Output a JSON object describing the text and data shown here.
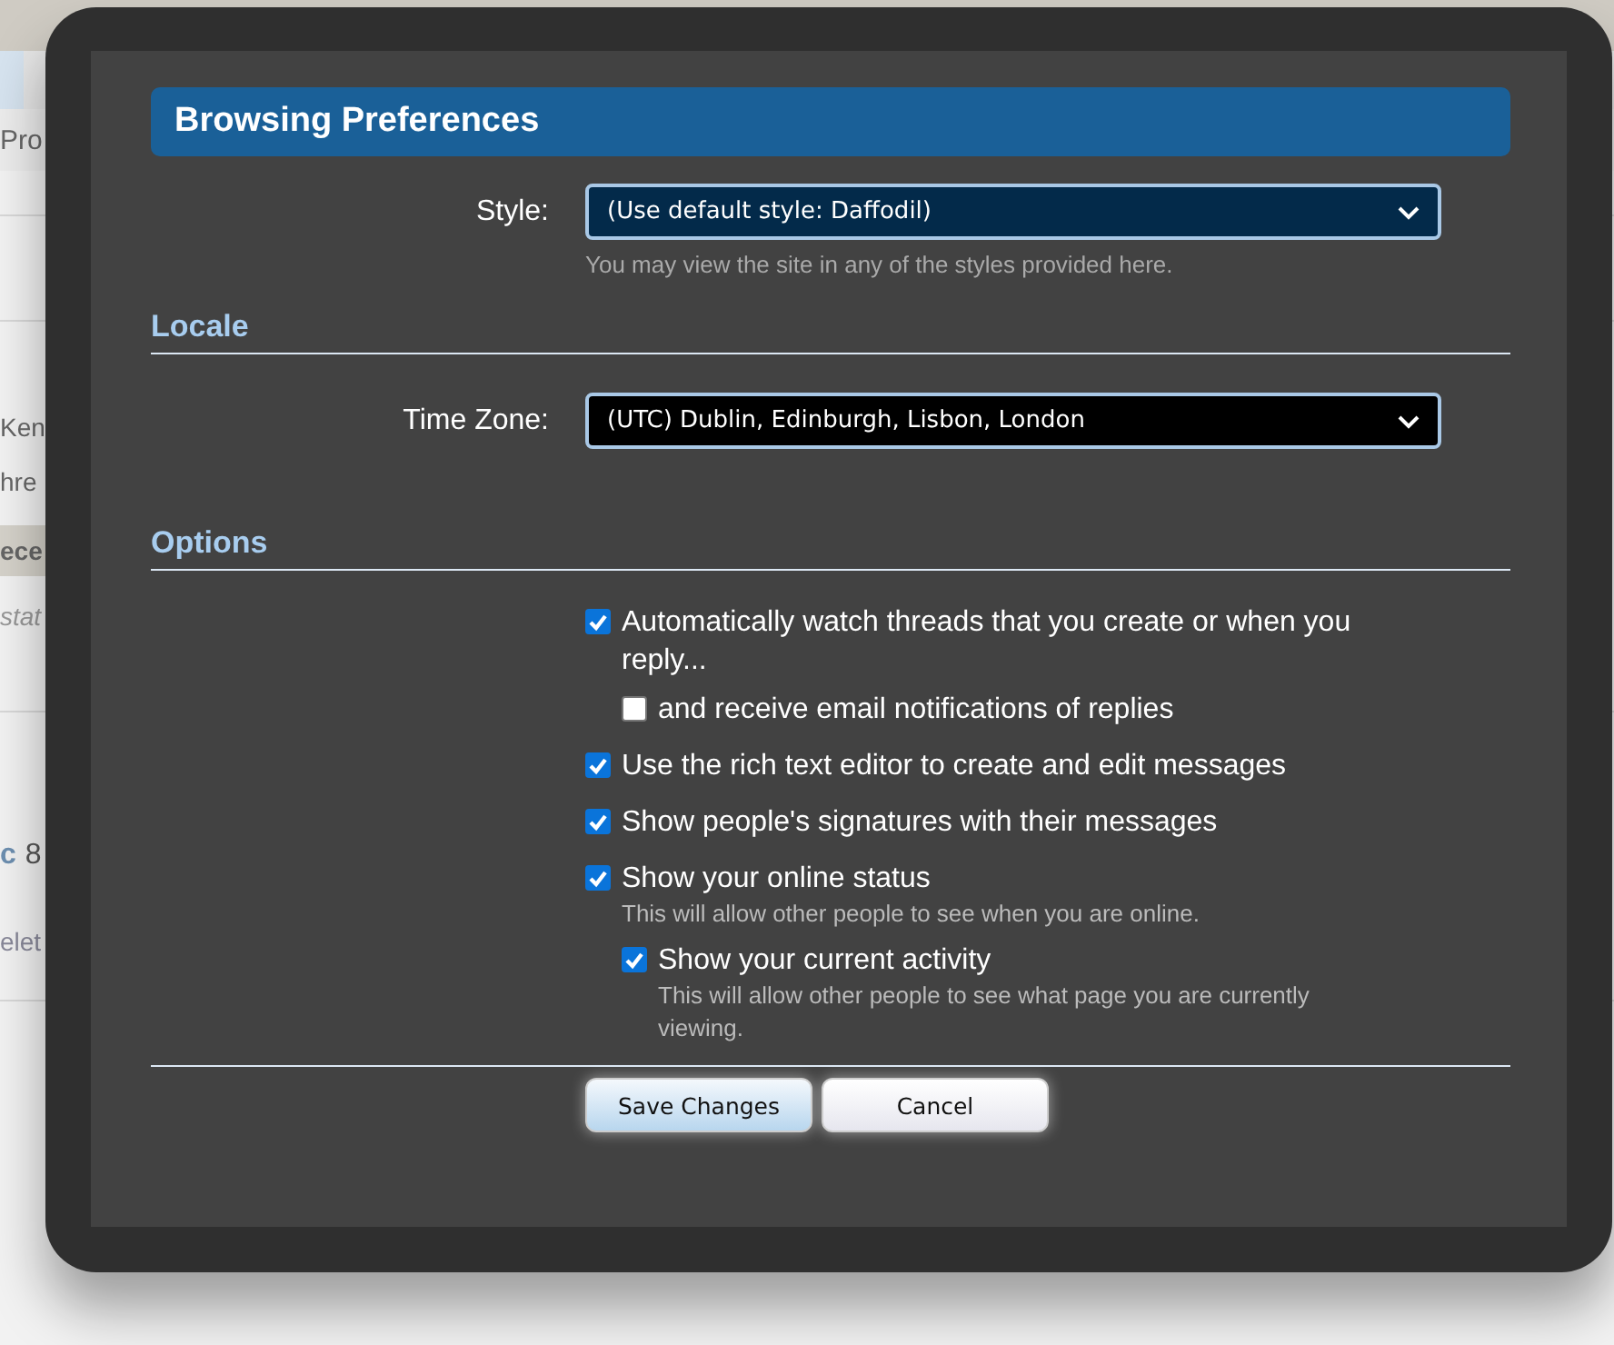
{
  "background_page": {
    "nav_tab": {
      "selected": true
    },
    "profile_tab": "Pro",
    "user_name": "Ken",
    "activity": "hre",
    "profile_tabs": [
      {
        "label": "ece"
      }
    ],
    "status_placeholder": "stat",
    "post": {
      "prefix": "c",
      "text": "8"
    },
    "post_actions": [
      "elet"
    ]
  },
  "dialog": {
    "title": "Browsing Preferences",
    "style": {
      "label": "Style:",
      "value": "(Use default style: Daffodil)",
      "hint": "You may view the site in any of the styles provided here."
    },
    "locale_heading": "Locale",
    "time_zone": {
      "label": "Time Zone:",
      "value": "(UTC) Dublin, Edinburgh, Lisbon, London"
    },
    "options_heading": "Options",
    "options": [
      {
        "label": "Automatically watch threads that you create or when you reply...",
        "checked": true,
        "children": [
          {
            "label": "and receive email notifications of replies",
            "checked": false
          }
        ]
      },
      {
        "label": "Use the rich text editor to create and edit messages",
        "checked": true
      },
      {
        "label": "Show people's signatures with their messages",
        "checked": true
      },
      {
        "label": "Show your online status",
        "checked": true,
        "hint": "This will allow other people to see when you are online.",
        "children": [
          {
            "label": "Show your current activity",
            "checked": true,
            "hint": "This will allow other people to see what page you are currently viewing."
          }
        ]
      }
    ],
    "buttons": [
      {
        "label": "Save Changes",
        "kind": "primary"
      },
      {
        "label": "Cancel",
        "kind": "secondary"
      }
    ]
  }
}
